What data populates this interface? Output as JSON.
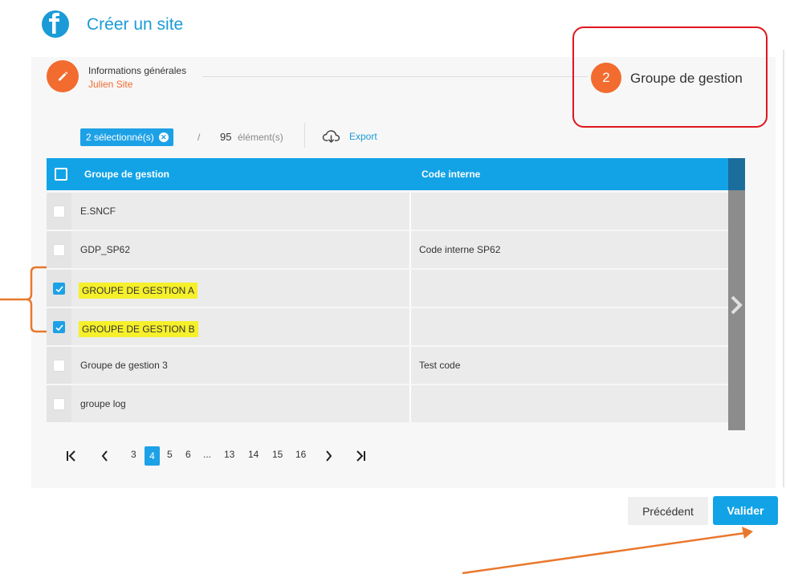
{
  "header": {
    "title": "Créer un site"
  },
  "steps": {
    "step1": {
      "title": "Informations générales",
      "subtitle": "Julien Site"
    },
    "step2": {
      "number": "2",
      "label": "Groupe de gestion"
    }
  },
  "toolbar": {
    "selected_label": "2 sélectionné(s)",
    "slash": "/",
    "count": "95",
    "count_label": "élément(s)",
    "export_label": "Export"
  },
  "table": {
    "columns": [
      "Groupe de gestion",
      "Code interne"
    ],
    "rows": [
      {
        "name": "E.SNCF",
        "code": "",
        "checked": false
      },
      {
        "name": "GDP_SP62",
        "code": "Code interne SP62",
        "checked": false
      },
      {
        "name": "GROUPE DE GESTION A",
        "code": "",
        "checked": true
      },
      {
        "name": "GROUPE DE GESTION B",
        "code": "",
        "checked": true
      },
      {
        "name": "Groupe de gestion 3",
        "code": "Test code",
        "checked": false
      },
      {
        "name": "groupe log",
        "code": "",
        "checked": false
      }
    ]
  },
  "pagination": {
    "pages": [
      "3",
      "4",
      "5",
      "6",
      "...",
      "13",
      "14",
      "15",
      "16"
    ],
    "current": "4"
  },
  "buttons": {
    "previous": "Précédent",
    "validate": "Valider"
  },
  "colors": {
    "accent": "#12a3e6",
    "orange": "#f26b2f",
    "highlight": "#f6f02a",
    "annotation_red": "#e0161e",
    "annotation_orange": "#e8782d"
  }
}
